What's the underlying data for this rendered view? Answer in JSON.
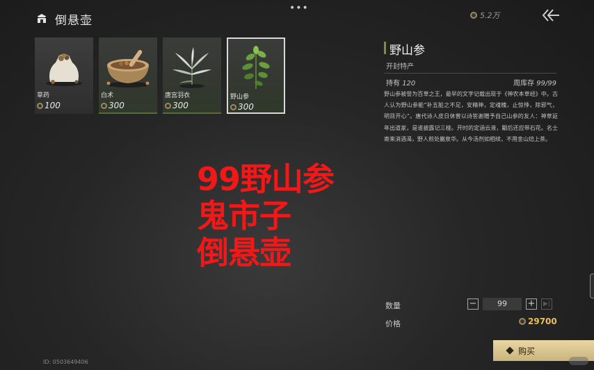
{
  "header": {
    "icon": "shop-roof-icon",
    "title": "倒悬壶",
    "menu_dots": "•••",
    "currency": "5.2万",
    "back_icon": "back-arrow-icon"
  },
  "items": [
    {
      "name": "草药",
      "price": "100",
      "icon": "herb-sack-icon",
      "selected": false
    },
    {
      "name": "白术",
      "price": "300",
      "icon": "mortar-herbs-icon",
      "selected": false
    },
    {
      "name": "唐宫羽衣",
      "price": "300",
      "icon": "silver-leaf-plant-icon",
      "selected": false
    },
    {
      "name": "野山参",
      "price": "300",
      "icon": "ginseng-plant-icon",
      "selected": true
    }
  ],
  "detail": {
    "name": "野山参",
    "subtitle": "开封特产",
    "own_label": "持有",
    "own_value": "120",
    "stock_label": "周库存",
    "stock_value": "99/99",
    "description": "野山参被誉为百草之王，最早的文字记载出现于《神农本草经》中。古人认为野山参能“补五脏之不足，安精神，定魂魄，止惊悸，除邪气，明目开心”。唐代诗人皮日休曾以诗答谢赠予自己山参的友人：神草延年出道家，是谁披露记三桠。开时的定涵云液，劚后还应带石花。名士寄来消酒渴，野人煎处撇泉华。从今汤剂如相续，不用金山焙上茶。"
  },
  "overlay": {
    "line1": "99野山参",
    "line2": "鬼市子",
    "line3": "倒悬壶"
  },
  "purchase": {
    "qty_label": "数量",
    "qty_value": "99",
    "price_label": "价格",
    "total": "29700",
    "buy_label": "购买",
    "minus": "−",
    "plus": "+",
    "max": "▶|"
  },
  "footer": {
    "player_id": "ID: 0503649406"
  },
  "colors": {
    "accent_green": "#5a6b3c",
    "gold": "#e8c060",
    "overlay_red": "#f01818"
  }
}
